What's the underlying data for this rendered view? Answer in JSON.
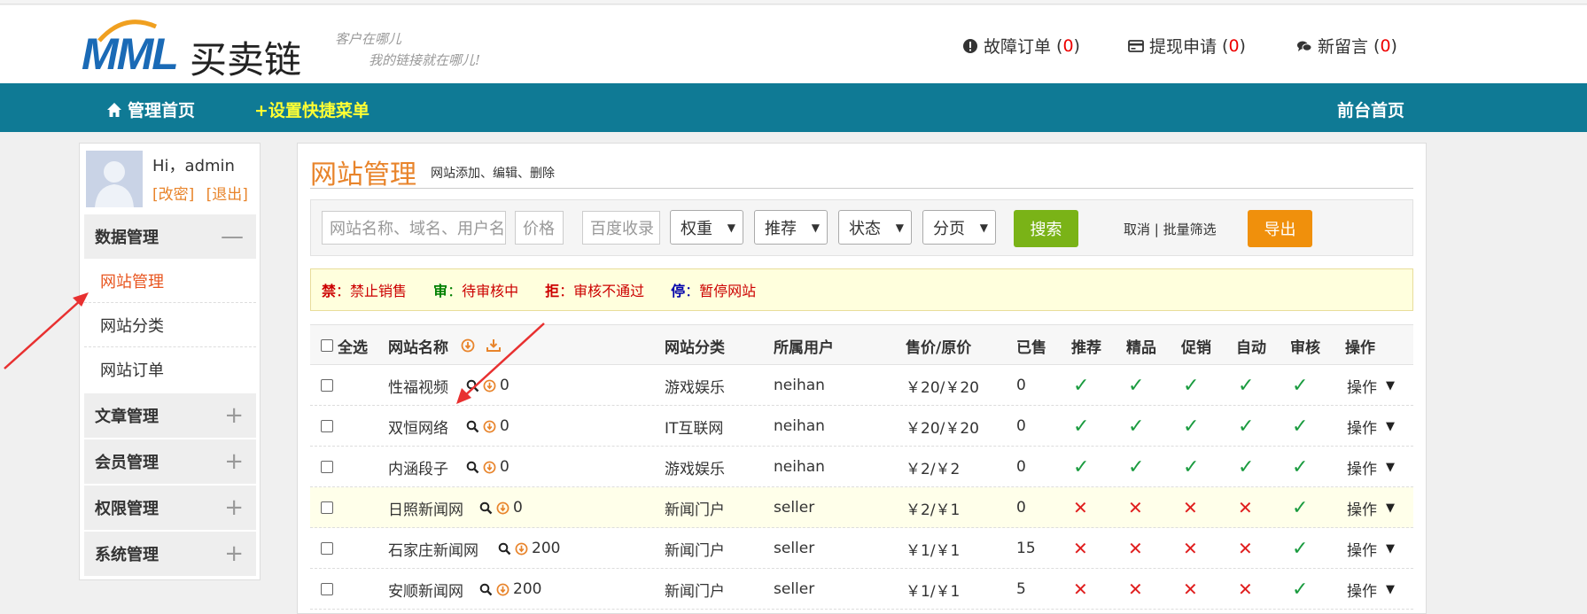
{
  "header": {
    "logo_mml": "MML",
    "logo_cn": "买卖链",
    "slogan_line1": "客户在哪儿",
    "slogan_line2": "我的链接就在哪儿!",
    "stats": [
      {
        "label": "故障订单",
        "count": "0",
        "icon": "exclamation-circle-icon"
      },
      {
        "label": "提现申请",
        "count": "0",
        "icon": "credit-card-icon"
      },
      {
        "label": "新留言",
        "count": "0",
        "icon": "chat-bubble-icon"
      }
    ]
  },
  "nav": {
    "home": "管理首页",
    "shortcut": "+设置快捷菜单",
    "frontend": "前台首页"
  },
  "sidebar": {
    "greeting": "Hi，admin",
    "edit_link": "[改密]",
    "logout_link": "[退出]",
    "groups": [
      {
        "label": "数据管理",
        "sign": "—"
      },
      {
        "label": "文章管理",
        "sign": "+"
      },
      {
        "label": "会员管理",
        "sign": "+"
      },
      {
        "label": "权限管理",
        "sign": "+"
      },
      {
        "label": "系统管理",
        "sign": "+"
      }
    ],
    "items": [
      {
        "label": "网站管理"
      },
      {
        "label": "网站分类"
      },
      {
        "label": "网站订单"
      }
    ]
  },
  "main": {
    "title": "网站管理",
    "subtitle": "网站添加、编辑、删除",
    "filters": {
      "name_placeholder": "网站名称、域名、用户名",
      "price_placeholder": "价格",
      "baidu_placeholder": "百度收录",
      "weight": "权重",
      "recommend": "推荐",
      "status": "状态",
      "paging": "分页",
      "search_btn": "搜索",
      "cancel_batch": "取消 | 批量筛选",
      "export_btn": "导出"
    },
    "legend": [
      {
        "key": "禁",
        "text": "禁止销售",
        "color": "#cc0000"
      },
      {
        "key": "审",
        "text": "待审核中",
        "color": "#008000"
      },
      {
        "key": "拒",
        "text": "审核不通过",
        "color": "#cc0000"
      },
      {
        "key": "停",
        "text": "暂停网站",
        "color": "#0000aa"
      }
    ],
    "legend_sep": "：",
    "table": {
      "headers": {
        "select_all": "全选",
        "name": "网站名称",
        "category": "网站分类",
        "user": "所属用户",
        "price": "售价/原价",
        "sold": "已售",
        "recommend": "推荐",
        "featured": "精品",
        "promo": "促销",
        "auto": "自动",
        "audit": "审核",
        "action": "操作"
      },
      "rows": [
        {
          "name": "性福视频",
          "count": "0",
          "category": "游戏娱乐",
          "user": "neihan",
          "price": "￥20/￥20",
          "sold": "0",
          "flags": [
            true,
            true,
            true,
            true,
            true
          ],
          "action": "操作"
        },
        {
          "name": "双恒网络",
          "count": "0",
          "category": "IT互联网",
          "user": "neihan",
          "price": "￥20/￥20",
          "sold": "0",
          "flags": [
            true,
            true,
            true,
            true,
            true
          ],
          "action": "操作"
        },
        {
          "name": "内涵段子",
          "count": "0",
          "category": "游戏娱乐",
          "user": "neihan",
          "price": "￥2/￥2",
          "sold": "0",
          "flags": [
            true,
            true,
            true,
            true,
            true
          ],
          "action": "操作"
        },
        {
          "name": "日照新闻网",
          "count": "0",
          "category": "新闻门户",
          "user": "seller",
          "price": "￥2/￥1",
          "sold": "0",
          "flags": [
            false,
            false,
            false,
            false,
            true
          ],
          "action": "操作"
        },
        {
          "name": "石家庄新闻网",
          "count": "200",
          "category": "新闻门户",
          "user": "seller",
          "price": "￥1/￥1",
          "sold": "15",
          "flags": [
            false,
            false,
            false,
            false,
            true
          ],
          "action": "操作"
        },
        {
          "name": "安顺新闻网",
          "count": "200",
          "category": "新闻门户",
          "user": "seller",
          "price": "￥1/￥1",
          "sold": "5",
          "flags": [
            false,
            false,
            false,
            false,
            true
          ],
          "action": "操作"
        }
      ]
    }
  },
  "colors": {
    "nav_bg": "#0f7a95",
    "accent_orange": "#e8842b",
    "search_green": "#7ab317",
    "export_orange": "#f0900c",
    "check_green": "#1a9b3f",
    "cross_red": "#e01e1e"
  }
}
